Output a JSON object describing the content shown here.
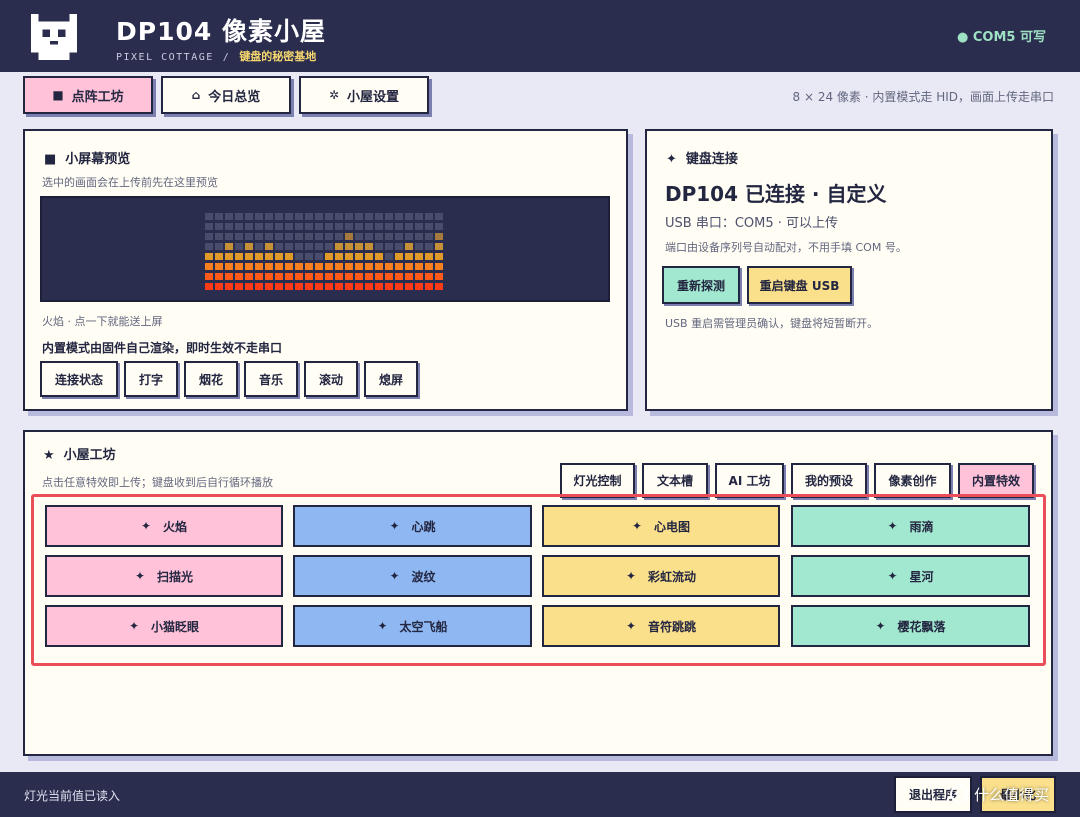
{
  "header": {
    "title": "DP104 像素小屋",
    "subtitle_en": "PIXEL COTTAGE",
    "subtitle_sep": "/",
    "subtitle_tag": "键盘的秘密基地",
    "com_status": "● COM5 可写",
    "logo_icon": "pixel-cat-icon"
  },
  "tabs": [
    {
      "label": "点阵工坊",
      "icon": "■",
      "active": true
    },
    {
      "label": "今日总览",
      "icon": "⌂",
      "active": false
    },
    {
      "label": "小屋设置",
      "icon": "✲",
      "active": false
    }
  ],
  "tabs_hint": "8 × 24 像素 · 内置模式走 HID，画面上传走串口",
  "preview": {
    "title": "小屏幕预览",
    "title_icon": "■",
    "desc": "选中的画面会在上传前先在这里预览",
    "status": "火焰 · 点一下就能送上屏",
    "note": "内置模式由固件自己渲染，即时生效不走串口",
    "mode_buttons": [
      "连接状态",
      "打字",
      "烟花",
      "音乐",
      "滚动",
      "熄屏"
    ],
    "column_levels": [
      4,
      4,
      5,
      4,
      5,
      4,
      5,
      4,
      4,
      3,
      3,
      3,
      4,
      5,
      6,
      5,
      5,
      4,
      3,
      4,
      5,
      4,
      4,
      6
    ]
  },
  "connection": {
    "title": "键盘连接",
    "title_icon": "✦",
    "headline": "DP104 已连接 · 自定义",
    "port_line": "USB 串口：COM5 · 可以上传",
    "port_hint": "端口由设备序列号自动配对，不用手填 COM 号。",
    "reprobe_label": "重新探测",
    "restart_label": "重启键盘 USB",
    "restart_hint": "USB 重启需管理员确认，键盘将短暂断开。"
  },
  "workshop": {
    "title": "小屋工坊",
    "title_icon": "★",
    "desc": "点击任意特效即上传；键盘收到后自行循环播放",
    "tabs": [
      {
        "label": "灯光控制",
        "active": false
      },
      {
        "label": "文本槽",
        "active": false
      },
      {
        "label": "AI 工坊",
        "active": false
      },
      {
        "label": "我的预设",
        "active": false
      },
      {
        "label": "像素创作",
        "active": false
      },
      {
        "label": "内置特效",
        "active": true
      }
    ],
    "effect_icon": "✦",
    "effects": [
      {
        "label": "火焰",
        "color": "pink"
      },
      {
        "label": "心跳",
        "color": "blue"
      },
      {
        "label": "心电图",
        "color": "yellow"
      },
      {
        "label": "雨滴",
        "color": "mint"
      },
      {
        "label": "扫描光",
        "color": "pink"
      },
      {
        "label": "波纹",
        "color": "blue"
      },
      {
        "label": "彩虹流动",
        "color": "yellow"
      },
      {
        "label": "星河",
        "color": "mint"
      },
      {
        "label": "小猫眨眼",
        "color": "pink"
      },
      {
        "label": "太空飞船",
        "color": "blue"
      },
      {
        "label": "音符跳跳",
        "color": "yellow"
      },
      {
        "label": "樱花飘落",
        "color": "mint"
      }
    ]
  },
  "footer": {
    "status": "灯光当前值已读入",
    "exit_label": "退出程序",
    "minimize_label": "最小化",
    "watermark": "什么值得买"
  },
  "colors": {
    "header_bg": "#2b2d4e",
    "page_bg": "#e8e9f5",
    "pink": "#ffc2d9",
    "blue": "#8fb8f2",
    "yellow": "#fbe08c",
    "mint": "#a2e7cf",
    "highlight": "#ea4e58",
    "com_ok": "#9de0c3"
  }
}
